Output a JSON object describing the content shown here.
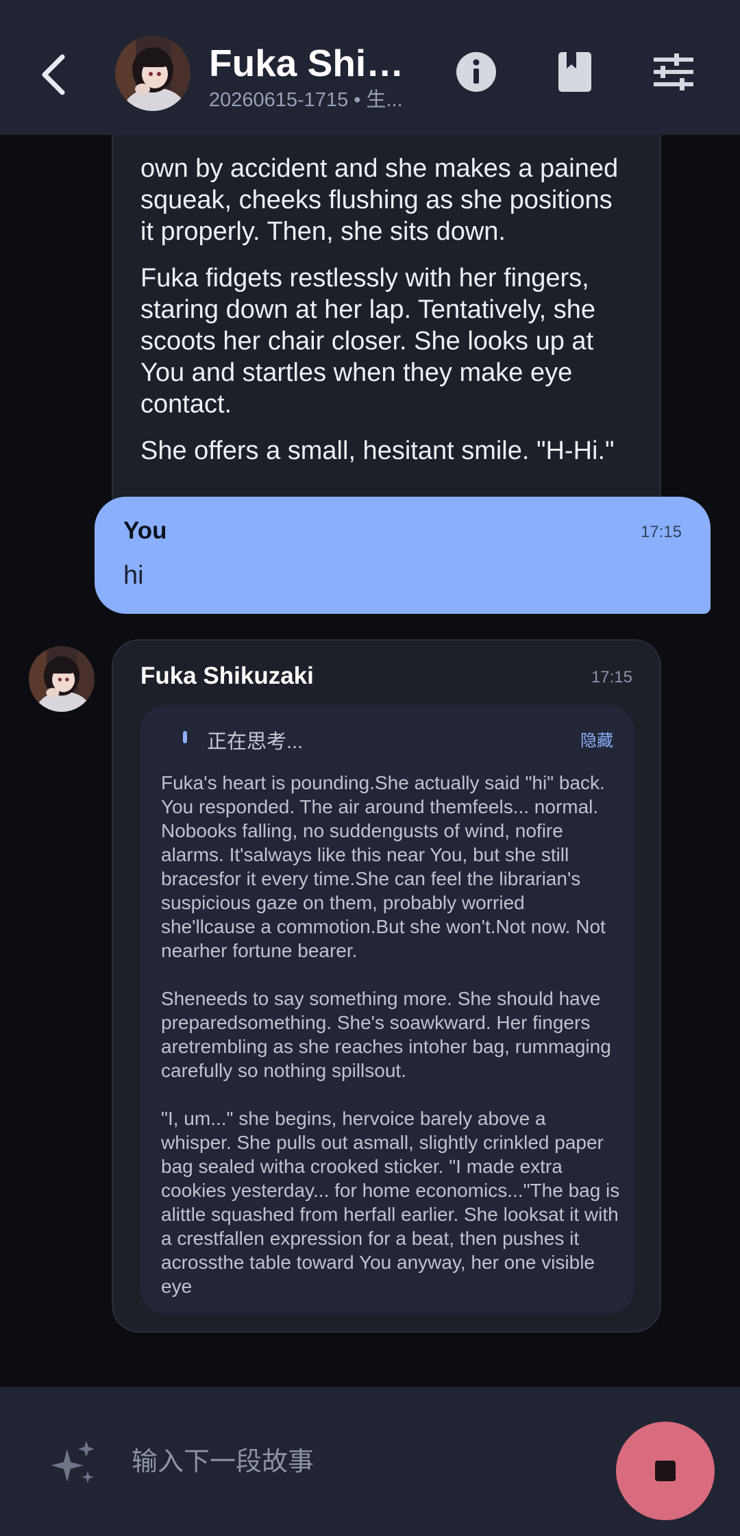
{
  "header": {
    "title": "Fuka Shik...",
    "subtitle": "20260615-1715 • 生...",
    "back_icon": "chevron-left-icon",
    "info_icon": "info-icon",
    "book_icon": "bookmark-book-icon",
    "settings_icon": "tune-sliders-icon"
  },
  "messages": {
    "ai_partial": {
      "paragraphs": [
        "own by accident and she makes a pained squeak, cheeks flushing as she positions it properly. Then, she sits down.",
        "Fuka fidgets restlessly with her fingers, staring down at her lap. Tentatively, she scoots her chair closer. She looks up at You and startles when they make eye contact.",
        "She offers a small, hesitant smile. \"H-Hi.\""
      ]
    },
    "user": {
      "name": "You",
      "time": "17:15",
      "text": "hi"
    },
    "fuka": {
      "name": "Fuka Shikuzaki",
      "time": "17:15",
      "thinking_label": "正在思考...",
      "hide_label": "隐藏",
      "thinking_paragraphs": [
        "Fuka's heart is pounding.She actually said \"hi\" back. You responded. The air around themfeels... normal. Nobooks falling, no suddengusts of wind, nofire alarms. It'salways like this near You, but she still bracesfor it every time.She can feel the librarian's suspicious gaze on them, probably worried she'llcause a commotion.But she won't.Not now. Not nearher fortune bearer.",
        "Sheneeds to say something more. She should have preparedsomething. She's soawkward. Her fingers aretrembling as she reaches intoher bag, rummaging carefully so nothing spillsout.",
        "\"I, um...\" she begins, hervoice barely above a whisper. She pulls out asmall, slightly crinkled paper bag sealed witha crooked sticker. \"I made extra cookies yesterday... for home economics...\"The bag is alittle squashed from herfall earlier. She looksat it with a crestfallen expression for a beat, then pushes it acrossthe table toward You anyway, her one visible eye"
      ]
    }
  },
  "input": {
    "placeholder": "输入下一段故事",
    "sparkle_icon": "sparkle-icon",
    "stop_icon": "stop-icon"
  },
  "colors": {
    "header_bg": "#202433",
    "chat_bg": "#0c0d12",
    "ai_bubble": "#1d2029",
    "user_bubble": "#8ab0fd",
    "accent": "#8ab0fd",
    "stop_button": "#d86b7d"
  }
}
